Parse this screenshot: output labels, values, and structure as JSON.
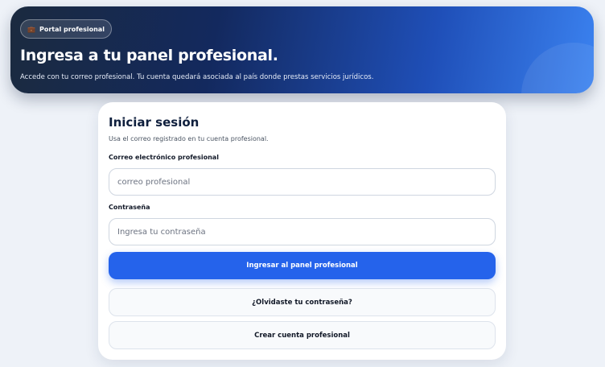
{
  "hero": {
    "badge_icon": "briefcase-icon",
    "badge_label": "Portal profesional",
    "title": "Ingresa a tu panel profesional.",
    "subtitle": "Accede con tu correo profesional. Tu cuenta quedará asociada al país donde prestas servicios jurídicos."
  },
  "login": {
    "title": "Iniciar sesión",
    "subtitle": "Usa el correo registrado en tu cuenta profesional.",
    "email_label": "Correo electrónico profesional",
    "email_placeholder": "correo profesional",
    "email_value": "",
    "password_label": "Contraseña",
    "password_placeholder": "Ingresa tu contraseña",
    "password_value": "",
    "submit_label": "Ingresar al panel profesional",
    "forgot_label": "¿Olvidaste tu contraseña?",
    "create_label": "Crear cuenta profesional"
  },
  "colors": {
    "primary": "#2563eb",
    "hero_dark": "#13295e",
    "page_bg": "#eef2f8"
  }
}
